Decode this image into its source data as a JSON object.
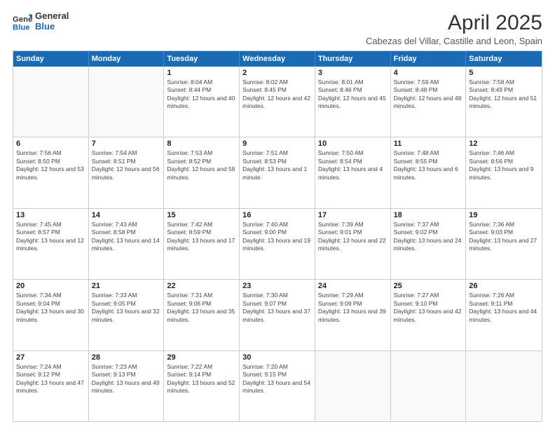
{
  "logo": {
    "line1": "General",
    "line2": "Blue"
  },
  "title": "April 2025",
  "subtitle": "Cabezas del Villar, Castille and Leon, Spain",
  "header_days": [
    "Sunday",
    "Monday",
    "Tuesday",
    "Wednesday",
    "Thursday",
    "Friday",
    "Saturday"
  ],
  "rows": [
    [
      {
        "day": "",
        "text": ""
      },
      {
        "day": "",
        "text": ""
      },
      {
        "day": "1",
        "text": "Sunrise: 8:04 AM\nSunset: 8:44 PM\nDaylight: 12 hours and 40 minutes."
      },
      {
        "day": "2",
        "text": "Sunrise: 8:02 AM\nSunset: 8:45 PM\nDaylight: 12 hours and 42 minutes."
      },
      {
        "day": "3",
        "text": "Sunrise: 8:01 AM\nSunset: 8:46 PM\nDaylight: 12 hours and 45 minutes."
      },
      {
        "day": "4",
        "text": "Sunrise: 7:59 AM\nSunset: 8:48 PM\nDaylight: 12 hours and 48 minutes."
      },
      {
        "day": "5",
        "text": "Sunrise: 7:58 AM\nSunset: 8:49 PM\nDaylight: 12 hours and 51 minutes."
      }
    ],
    [
      {
        "day": "6",
        "text": "Sunrise: 7:56 AM\nSunset: 8:50 PM\nDaylight: 12 hours and 53 minutes."
      },
      {
        "day": "7",
        "text": "Sunrise: 7:54 AM\nSunset: 8:51 PM\nDaylight: 12 hours and 56 minutes."
      },
      {
        "day": "8",
        "text": "Sunrise: 7:53 AM\nSunset: 8:52 PM\nDaylight: 12 hours and 58 minutes."
      },
      {
        "day": "9",
        "text": "Sunrise: 7:51 AM\nSunset: 8:53 PM\nDaylight: 13 hours and 1 minute."
      },
      {
        "day": "10",
        "text": "Sunrise: 7:50 AM\nSunset: 8:54 PM\nDaylight: 13 hours and 4 minutes."
      },
      {
        "day": "11",
        "text": "Sunrise: 7:48 AM\nSunset: 8:55 PM\nDaylight: 13 hours and 6 minutes."
      },
      {
        "day": "12",
        "text": "Sunrise: 7:46 AM\nSunset: 8:56 PM\nDaylight: 13 hours and 9 minutes."
      }
    ],
    [
      {
        "day": "13",
        "text": "Sunrise: 7:45 AM\nSunset: 8:57 PM\nDaylight: 13 hours and 12 minutes."
      },
      {
        "day": "14",
        "text": "Sunrise: 7:43 AM\nSunset: 8:58 PM\nDaylight: 13 hours and 14 minutes."
      },
      {
        "day": "15",
        "text": "Sunrise: 7:42 AM\nSunset: 8:59 PM\nDaylight: 13 hours and 17 minutes."
      },
      {
        "day": "16",
        "text": "Sunrise: 7:40 AM\nSunset: 9:00 PM\nDaylight: 13 hours and 19 minutes."
      },
      {
        "day": "17",
        "text": "Sunrise: 7:39 AM\nSunset: 9:01 PM\nDaylight: 13 hours and 22 minutes."
      },
      {
        "day": "18",
        "text": "Sunrise: 7:37 AM\nSunset: 9:02 PM\nDaylight: 13 hours and 24 minutes."
      },
      {
        "day": "19",
        "text": "Sunrise: 7:36 AM\nSunset: 9:03 PM\nDaylight: 13 hours and 27 minutes."
      }
    ],
    [
      {
        "day": "20",
        "text": "Sunrise: 7:34 AM\nSunset: 9:04 PM\nDaylight: 13 hours and 30 minutes."
      },
      {
        "day": "21",
        "text": "Sunrise: 7:33 AM\nSunset: 9:05 PM\nDaylight: 13 hours and 32 minutes."
      },
      {
        "day": "22",
        "text": "Sunrise: 7:31 AM\nSunset: 9:06 PM\nDaylight: 13 hours and 35 minutes."
      },
      {
        "day": "23",
        "text": "Sunrise: 7:30 AM\nSunset: 9:07 PM\nDaylight: 13 hours and 37 minutes."
      },
      {
        "day": "24",
        "text": "Sunrise: 7:29 AM\nSunset: 9:09 PM\nDaylight: 13 hours and 39 minutes."
      },
      {
        "day": "25",
        "text": "Sunrise: 7:27 AM\nSunset: 9:10 PM\nDaylight: 13 hours and 42 minutes."
      },
      {
        "day": "26",
        "text": "Sunrise: 7:26 AM\nSunset: 9:11 PM\nDaylight: 13 hours and 44 minutes."
      }
    ],
    [
      {
        "day": "27",
        "text": "Sunrise: 7:24 AM\nSunset: 9:12 PM\nDaylight: 13 hours and 47 minutes."
      },
      {
        "day": "28",
        "text": "Sunrise: 7:23 AM\nSunset: 9:13 PM\nDaylight: 13 hours and 49 minutes."
      },
      {
        "day": "29",
        "text": "Sunrise: 7:22 AM\nSunset: 9:14 PM\nDaylight: 13 hours and 52 minutes."
      },
      {
        "day": "30",
        "text": "Sunrise: 7:20 AM\nSunset: 9:15 PM\nDaylight: 13 hours and 54 minutes."
      },
      {
        "day": "",
        "text": ""
      },
      {
        "day": "",
        "text": ""
      },
      {
        "day": "",
        "text": ""
      }
    ]
  ]
}
